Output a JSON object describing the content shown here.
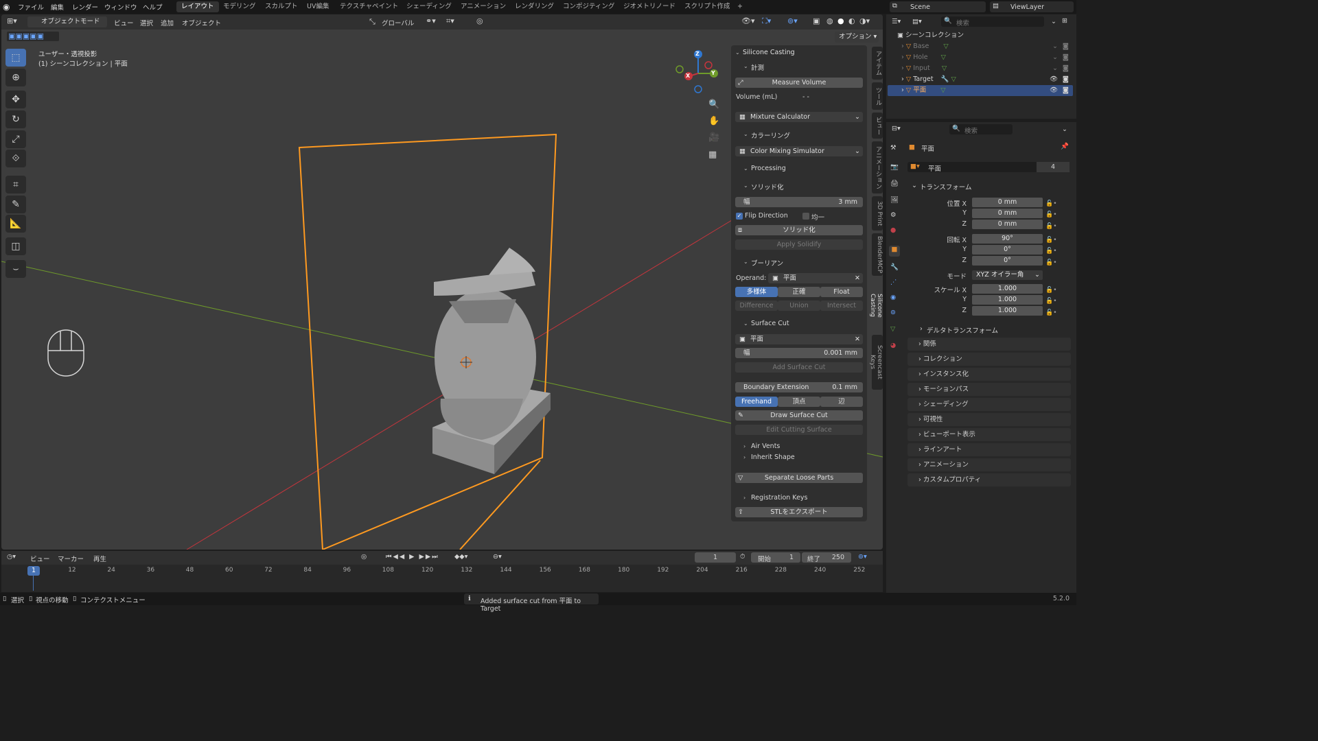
{
  "menu": {
    "items": [
      "ファイル",
      "編集",
      "レンダー",
      "ウィンドウ",
      "ヘルプ"
    ]
  },
  "workspaces": [
    "レイアウト",
    "モデリング",
    "スカルプト",
    "UV編集",
    "テクスチャペイント",
    "シェーディング",
    "アニメーション",
    "レンダリング",
    "コンポジティング",
    "ジオメトリノード",
    "スクリプト作成"
  ],
  "scene": {
    "name": "Scene",
    "view_layer": "ViewLayer"
  },
  "viewport": {
    "mode": "オブジェクトモード",
    "menus": [
      "ビュー",
      "選択",
      "追加",
      "オブジェクト"
    ],
    "transform_orientation": "グローバル",
    "options": "オプション",
    "overlay_title": "ユーザー・透視投影",
    "overlay_subtitle": "(1) シーンコレクション | 平面",
    "gizmo": {
      "x": "X",
      "y": "Y",
      "z": "Z"
    }
  },
  "npanel": {
    "title": "Silicone Casting",
    "measure_section": "計測",
    "measure_button": "Measure Volume",
    "volume_label": "Volume (mL)",
    "volume_value": "- -",
    "mixture": "Mixture Calculator",
    "coloring_section": "カラーリング",
    "color_sim": "Color Mixing Simulator",
    "processing": "Processing",
    "solidify_section": "ソリッド化",
    "width_label": "幅",
    "width_value": "3 mm",
    "flip": "Flip Direction",
    "even": "均一",
    "solidify_button": "ソリッド化",
    "apply_solidify": "Apply Solidify",
    "boolean_section": "ブーリアン",
    "operand_label": "Operand:",
    "operand_value": "平面",
    "solver": [
      "多様体",
      "正確",
      "Float"
    ],
    "ops": [
      "Difference",
      "Union",
      "Intersect"
    ],
    "surface_cut": "Surface Cut",
    "cut_object": "平面",
    "cut_width_label": "幅",
    "cut_width_value": "0.001 mm",
    "add_surface_cut": "Add Surface Cut",
    "boundary_label": "Boundary Extension",
    "boundary_value": "0.1 mm",
    "draw_modes": [
      "Freehand",
      "頂点",
      "辺"
    ],
    "draw_surface_cut": "Draw Surface Cut",
    "edit_cutting": "Edit Cutting Surface",
    "air_vents": "Air Vents",
    "inherit_shape": "Inherit Shape",
    "separate": "Separate Loose Parts",
    "registration": "Registration Keys",
    "export": "STLをエクスポート"
  },
  "side_tabs": [
    "アイテム",
    "ツール",
    "ビュー",
    "アニメーション",
    "3D Print",
    "BlenderMCP",
    "Silicone Casting",
    "Screencast Keys"
  ],
  "outliner": {
    "search_placeholder": "検索",
    "root": "シーンコレクション",
    "items": [
      {
        "name": "Base",
        "dim": true
      },
      {
        "name": "Hole",
        "dim": true
      },
      {
        "name": "Input",
        "dim": true
      },
      {
        "name": "Target",
        "dim": false
      },
      {
        "name": "平面",
        "dim": false
      }
    ]
  },
  "properties": {
    "search_placeholder": "検索",
    "object_name": "平面",
    "data_name": "平面",
    "users": "4",
    "transform": "トランスフォーム",
    "loc_label": "位置 X",
    "loc": [
      "0 mm",
      "0 mm",
      "0 mm"
    ],
    "rot_label": "回転 X",
    "rot": [
      "90°",
      "0°",
      "0°"
    ],
    "mode_label": "モード",
    "mode_value": "XYZ オイラー角",
    "scale_label": "スケール X",
    "scale": [
      "1.000",
      "1.000",
      "1.000"
    ],
    "axis_y": "Y",
    "axis_z": "Z",
    "delta": "デルタトランスフォーム",
    "sections": [
      "関係",
      "コレクション",
      "インスタンス化",
      "モーションパス",
      "シェーディング",
      "可視性",
      "ビューポート表示",
      "ラインアート",
      "アニメーション",
      "カスタムプロパティ"
    ]
  },
  "timeline": {
    "menus": [
      "ビュー",
      "マーカー",
      "再生"
    ],
    "current_frame": "1",
    "start_label": "開始",
    "start": "1",
    "end_label": "終了",
    "end": "250",
    "ticks": [
      "1",
      "12",
      "24",
      "36",
      "48",
      "60",
      "72",
      "84",
      "96",
      "108",
      "120",
      "132",
      "144",
      "156",
      "168",
      "180",
      "192",
      "204",
      "216",
      "228",
      "240",
      "252"
    ]
  },
  "status": {
    "select": "選択",
    "move_view": "視点の移動",
    "context_menu": "コンテクストメニュー",
    "message": "Added surface cut from 平面 to Target",
    "version": "5.2.0"
  },
  "colors": {
    "accent": "#4772b3",
    "selection": "#ff9a20",
    "x_axis": "#c7353d",
    "y_axis": "#6f9b2a",
    "z_axis": "#2f78d2"
  }
}
